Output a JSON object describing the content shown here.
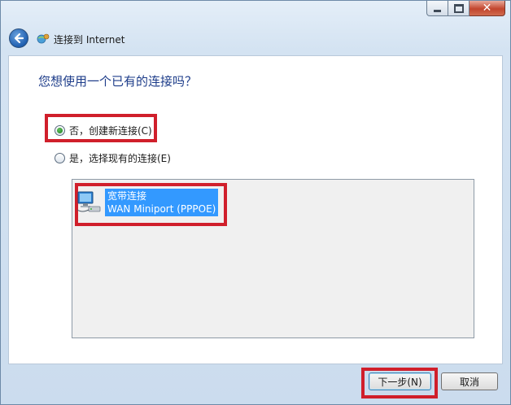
{
  "window": {
    "title": "连接到 Internet"
  },
  "page": {
    "heading": "您想使用一个已有的连接吗？"
  },
  "options": [
    {
      "label": "否，创建新连接(C)",
      "selected": true
    },
    {
      "label": "是，选择现有的连接(E)",
      "selected": false
    }
  ],
  "connections": [
    {
      "name": "宽带连接",
      "device": "WAN Miniport (PPPOE)",
      "icon": "network-computer-icon"
    }
  ],
  "buttons": {
    "next": "下一步(N)",
    "cancel": "取消"
  },
  "colors": {
    "annotation": "#d01f2b",
    "selection": "#3399ff",
    "heading": "#1e3d8a"
  }
}
